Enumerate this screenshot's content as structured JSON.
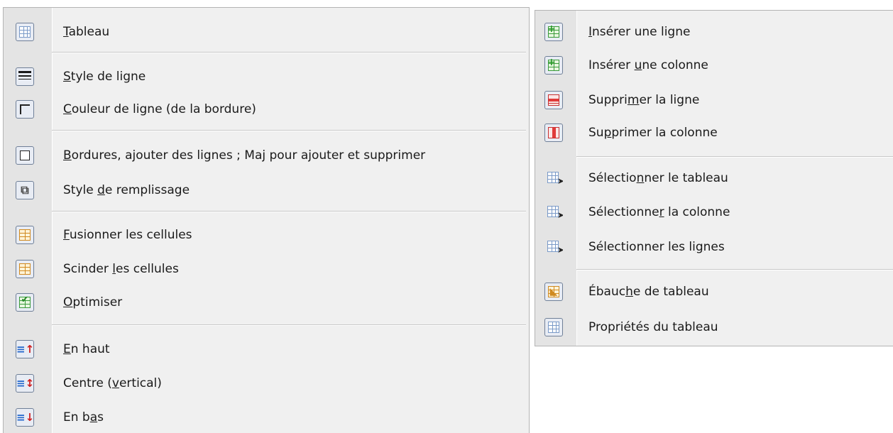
{
  "left_menu": {
    "items": [
      {
        "icon": "table-icon",
        "before": "",
        "accel": "T",
        "after": "ableau"
      },
      {
        "icon": "line-style-icon",
        "before": "",
        "accel": "S",
        "after": "tyle de ligne"
      },
      {
        "icon": "line-color-icon",
        "before": "",
        "accel": "C",
        "after": "ouleur de ligne (de la bordure)"
      },
      {
        "icon": "borders-icon",
        "before": "",
        "accel": "B",
        "after": "ordures, ajouter des lignes ; Maj pour ajouter et supprimer"
      },
      {
        "icon": "fill-style-icon",
        "before": "Style ",
        "accel": "d",
        "after": "e remplissage"
      },
      {
        "icon": "merge-cells-icon",
        "before": "",
        "accel": "F",
        "after": "usionner les cellules"
      },
      {
        "icon": "split-cells-icon",
        "before": "Scinder ",
        "accel": "l",
        "after": "es cellules"
      },
      {
        "icon": "optimize-icon",
        "before": "",
        "accel": "O",
        "after": "ptimiser"
      },
      {
        "icon": "align-top-icon",
        "before": "",
        "accel": "E",
        "after": "n haut"
      },
      {
        "icon": "align-center-vertical-icon",
        "before": "Centre (",
        "accel": "v",
        "after": "ertical)"
      },
      {
        "icon": "align-bottom-icon",
        "before": "En b",
        "accel": "a",
        "after": "s"
      }
    ]
  },
  "right_menu": {
    "items": [
      {
        "icon": "insert-row-icon",
        "before": "",
        "accel": "I",
        "after": "nsérer une ligne"
      },
      {
        "icon": "insert-column-icon",
        "before": "Insérer ",
        "accel": "u",
        "after": "ne colonne"
      },
      {
        "icon": "delete-row-icon",
        "before": "Suppri",
        "accel": "m",
        "after": "er la ligne"
      },
      {
        "icon": "delete-column-icon",
        "before": "Su",
        "accel": "p",
        "after": "primer la colonne"
      },
      {
        "icon": "select-table-icon",
        "before": "Sélectio",
        "accel": "n",
        "after": "ner le tableau"
      },
      {
        "icon": "select-column-icon",
        "before": "Sélectionne",
        "accel": "r",
        "after": " la colonne"
      },
      {
        "icon": "select-rows-icon",
        "before": "Sélectionner les li",
        "accel": "g",
        "after": "nes"
      },
      {
        "icon": "table-design-icon",
        "before": "Ébauc",
        "accel": "h",
        "after": "e de tableau"
      },
      {
        "icon": "table-properties-icon",
        "before": "Propriétés du tableau",
        "accel": "",
        "after": ""
      }
    ]
  }
}
